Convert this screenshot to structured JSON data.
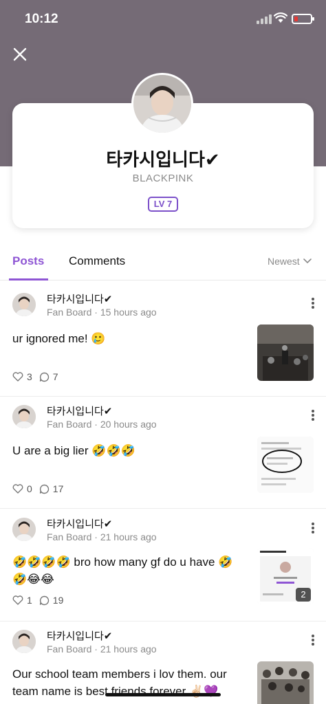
{
  "status_bar": {
    "time": "10:12"
  },
  "profile": {
    "name": "타카시입니다✔",
    "community": "BLACKPINK",
    "level": "LV 7"
  },
  "tabs": {
    "posts": "Posts",
    "comments": "Comments",
    "sort": "Newest"
  },
  "posts": [
    {
      "author": "타카시입니다✔",
      "board": "Fan Board",
      "time": "15 hours ago",
      "text": "ur ignored me! 🥲",
      "likes": "3",
      "comments": "7"
    },
    {
      "author": "타카시입니다✔",
      "board": "Fan Board",
      "time": "20 hours ago",
      "text": "U are a big lier 🤣🤣🤣",
      "likes": "0",
      "comments": "17"
    },
    {
      "author": "타카시입니다✔",
      "board": "Fan Board",
      "time": "21 hours ago",
      "text": "🤣🤣🤣🤣 bro how many gf do u have 🤣🤣😂😂",
      "likes": "1",
      "comments": "19",
      "image_count": "2"
    },
    {
      "author": "타카시입니다✔",
      "board": "Fan Board",
      "time": "21 hours ago",
      "text": "Our school team members i lov them. our team name is best friends forever ✌🏻💜",
      "likes": "",
      "comments": ""
    }
  ],
  "colors": {
    "header": "#756b76",
    "accent": "#8e55d4",
    "badge": "#7b4fc9"
  },
  "icons": [
    "close-icon",
    "heart-icon",
    "comment-icon",
    "more-icon",
    "chevron-down-icon"
  ]
}
